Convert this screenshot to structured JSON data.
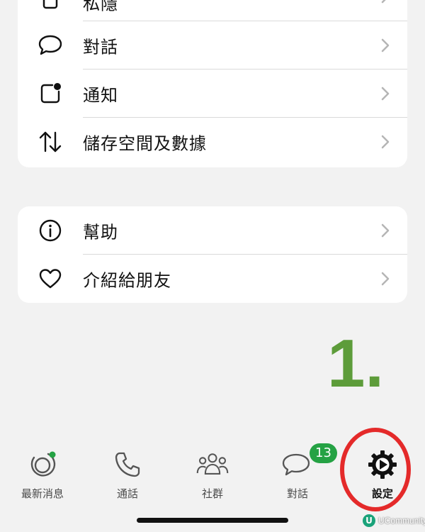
{
  "settings_groups": [
    {
      "items": [
        {
          "label": "私隱",
          "icon": "lock-icon"
        },
        {
          "label": "對話",
          "icon": "chat-bubble-icon"
        },
        {
          "label": "通知",
          "icon": "notification-icon"
        },
        {
          "label": "儲存空間及數據",
          "icon": "arrows-up-down-icon"
        }
      ]
    },
    {
      "items": [
        {
          "label": "幫助",
          "icon": "info-icon"
        },
        {
          "label": "介紹給朋友",
          "icon": "heart-icon"
        }
      ]
    }
  ],
  "annotation": {
    "step": "1.",
    "highlight_color": "#e42a2a",
    "step_color": "#5d9c3a"
  },
  "tabbar": {
    "tabs": [
      {
        "label": "最新消息",
        "icon": "updates-icon",
        "active": false
      },
      {
        "label": "通話",
        "icon": "phone-icon",
        "active": false
      },
      {
        "label": "社群",
        "icon": "community-icon",
        "active": false
      },
      {
        "label": "對話",
        "icon": "chats-icon",
        "active": false,
        "badge": "13"
      },
      {
        "label": "設定",
        "icon": "settings-gear-icon",
        "active": true
      }
    ],
    "badge_color": "#25a244"
  },
  "watermark": {
    "text": "UCommunity",
    "logo": "U"
  }
}
